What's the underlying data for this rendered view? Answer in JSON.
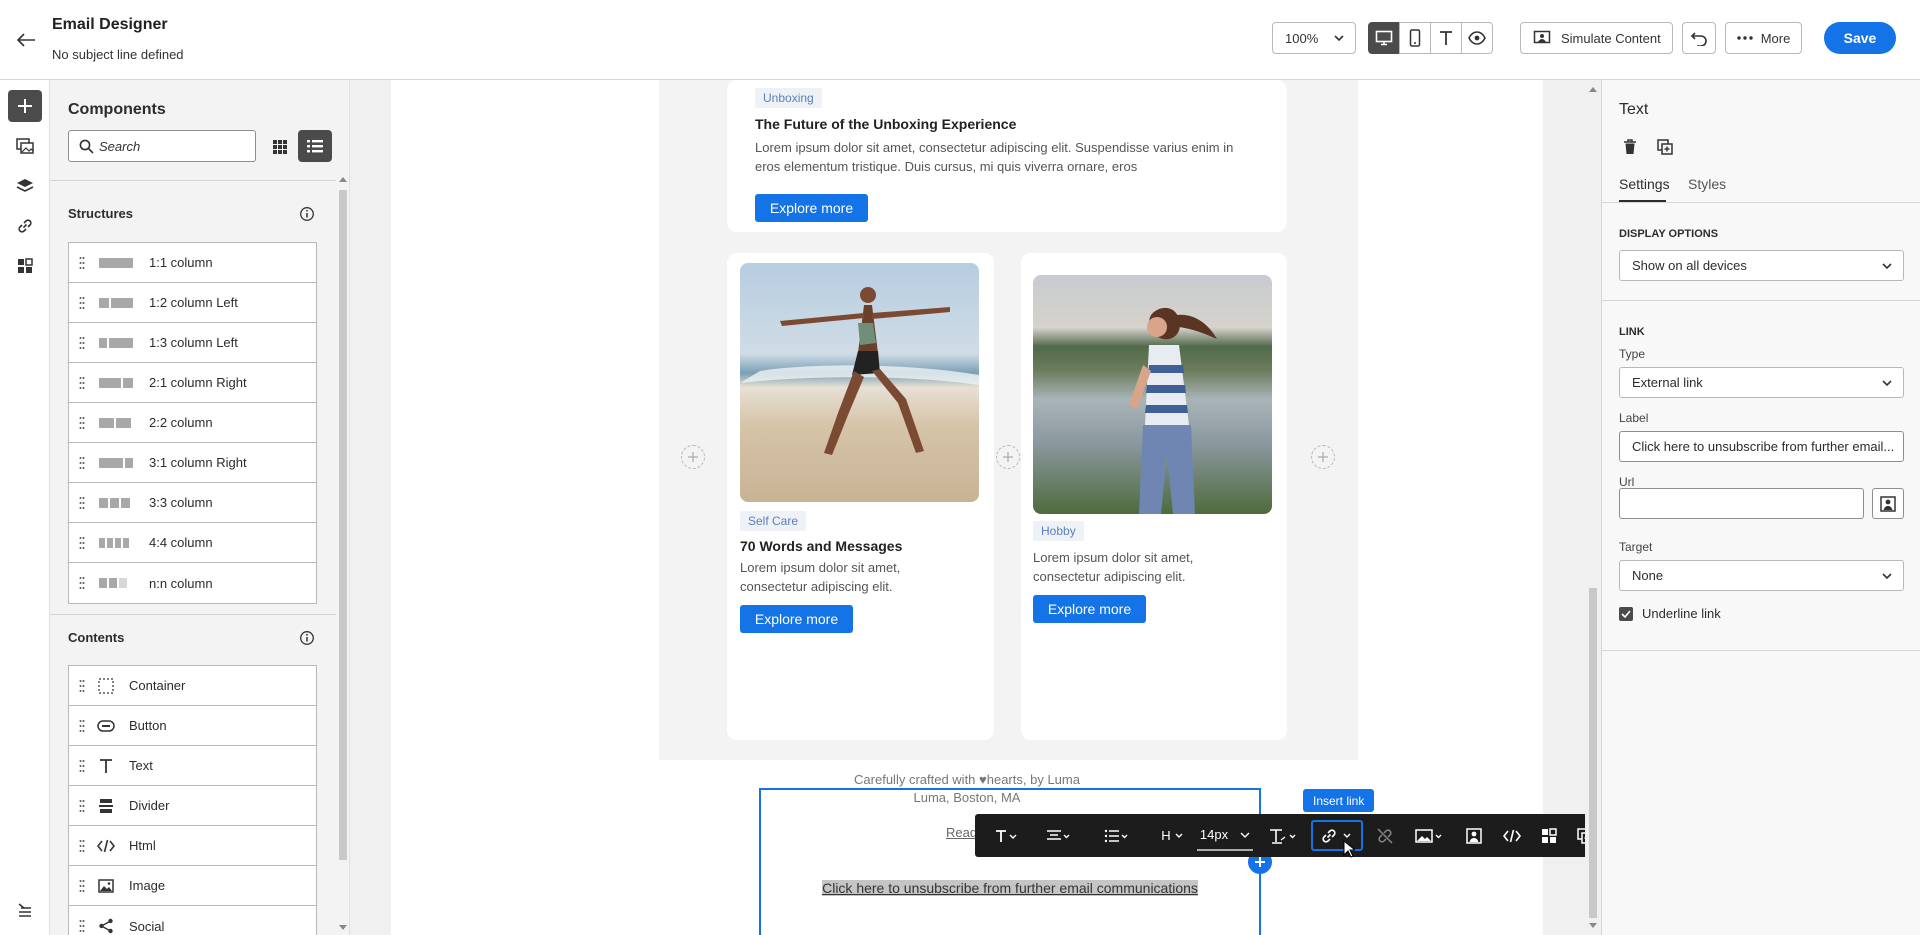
{
  "header": {
    "title": "Email Designer",
    "subtitle": "No subject line defined",
    "zoom": "100%",
    "simulate_label": "Simulate Content",
    "more_label": "More",
    "save_label": "Save"
  },
  "components": {
    "title": "Components",
    "search_placeholder": "Search",
    "structures_heading": "Structures",
    "structures": [
      {
        "label": "1:1 column"
      },
      {
        "label": "1:2 column Left"
      },
      {
        "label": "1:3 column Left"
      },
      {
        "label": "2:1 column Right"
      },
      {
        "label": "2:2 column"
      },
      {
        "label": "3:1 column Right"
      },
      {
        "label": "3:3 column"
      },
      {
        "label": "4:4 column"
      },
      {
        "label": "n:n column"
      }
    ],
    "contents_heading": "Contents",
    "contents": [
      {
        "label": "Container",
        "icon": "container-icon"
      },
      {
        "label": "Button",
        "icon": "button-icon"
      },
      {
        "label": "Text",
        "icon": "text-icon"
      },
      {
        "label": "Divider",
        "icon": "divider-icon"
      },
      {
        "label": "Html",
        "icon": "code-icon"
      },
      {
        "label": "Image",
        "icon": "image-icon"
      },
      {
        "label": "Social",
        "icon": "share-icon"
      }
    ]
  },
  "email": {
    "card_top": {
      "tag": "Unboxing",
      "title": "The Future of the Unboxing Experience",
      "text": "Lorem ipsum dolor sit amet, consectetur adipiscing elit. Suspendisse varius enim in eros elementum tristique. Duis cursus, mi quis viverra ornare, eros",
      "button": "Explore more"
    },
    "card_left": {
      "tag": "Self Care",
      "title": "70 Words and Messages",
      "text": "Lorem ipsum dolor sit amet, consectetur adipiscing elit.",
      "button": "Explore more"
    },
    "card_right": {
      "tag": "Hobby",
      "text": "Lorem ipsum dolor sit amet, consectetur adipiscing elit.",
      "button": "Explore more"
    },
    "footer_crafted": "Carefully crafted with ♥hearts, by Luma",
    "footer_address": "Luma, Boston, MA",
    "read_online": "Read this email online",
    "unsubscribe": "Click here to unsubscribe from further email communications",
    "tooltip": "Insert link",
    "font_size": "14px",
    "heading_btn": "H"
  },
  "settings": {
    "title": "Text",
    "tab_settings": "Settings",
    "tab_styles": "Styles",
    "display_heading": "DISPLAY OPTIONS",
    "display_value": "Show on all devices",
    "link_heading": "LINK",
    "type_label": "Type",
    "type_value": "External link",
    "label_label": "Label",
    "label_value": "Click here to unsubscribe from further email...",
    "url_label": "Url",
    "url_value": "",
    "target_label": "Target",
    "target_value": "None",
    "underline_label": "Underline link"
  },
  "colors": {
    "accent": "#1473e6",
    "toolbar": "#1c1c1c",
    "selected_dark": "#4b4b4b"
  }
}
